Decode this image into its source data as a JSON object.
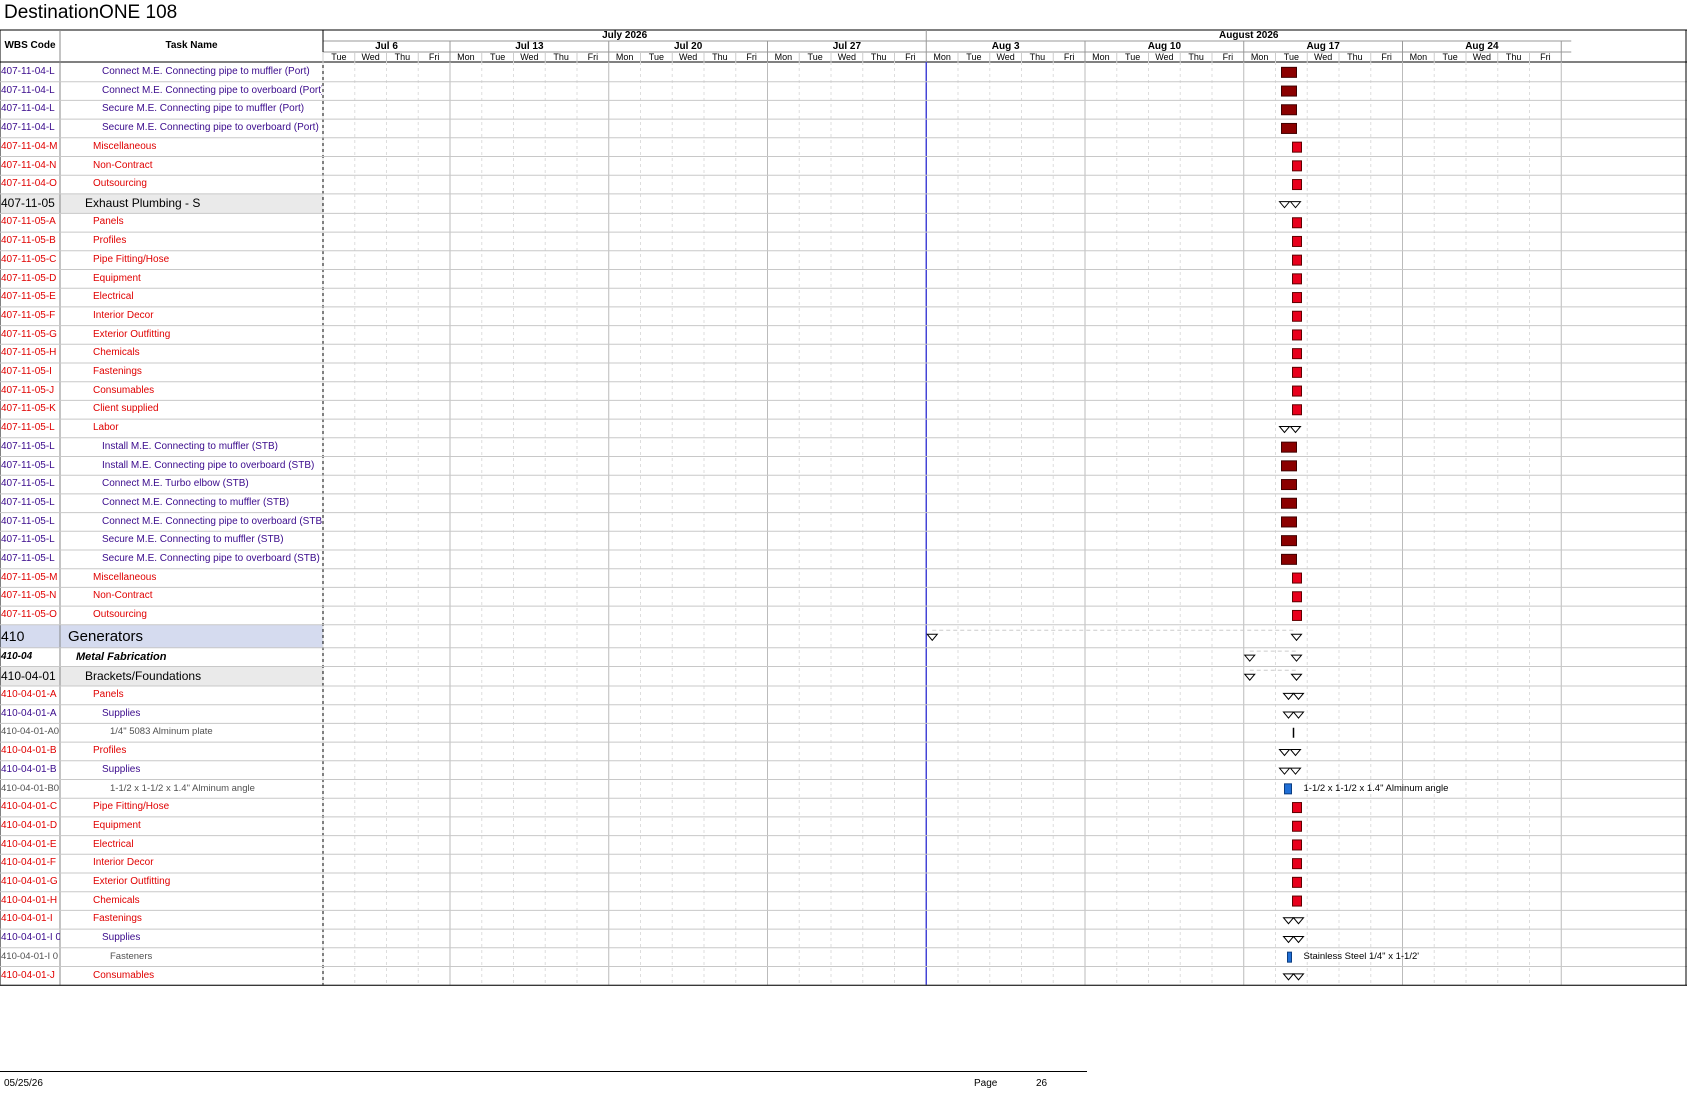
{
  "document": {
    "title": "DestinationONE 108"
  },
  "table_headers": {
    "wbs": "WBS Code",
    "name": "Task Name"
  },
  "months": [
    {
      "label": "July 2026"
    },
    {
      "label": "August 2026"
    }
  ],
  "weeks": [
    {
      "label": "Jul 6"
    },
    {
      "label": "Jul 13"
    },
    {
      "label": "Jul 20"
    },
    {
      "label": "Jul 27"
    },
    {
      "label": "Aug 3"
    },
    {
      "label": "Aug 10"
    },
    {
      "label": "Aug 17"
    },
    {
      "label": "Aug 24"
    }
  ],
  "days": [
    "Tue",
    "Wed",
    "Thu",
    "Fri",
    "Mon",
    "Tue",
    "Wed",
    "Thu",
    "Fri",
    "Mon",
    "Tue",
    "Wed",
    "Thu",
    "Fri",
    "Mon",
    "Tue",
    "Wed",
    "Thu",
    "Fri",
    "Mon",
    "Tue",
    "Wed",
    "Thu",
    "Fri",
    "Mon",
    "Tue",
    "Wed",
    "Thu",
    "Fri",
    "Mon",
    "Tue",
    "Wed",
    "Thu",
    "Fri",
    "Mon",
    "Tue",
    "Wed",
    "Thu",
    "Fri"
  ],
  "colors": {
    "red_text": "#e00000",
    "purple_text": "#3a0a8c",
    "gray_text": "#505050",
    "dark_red_bar": "#8b0000",
    "red_bar": "#e8001c",
    "blue_bar": "#1f6fd6",
    "summary_bg": "#eaeaea",
    "level1_bg": "#d5dbef",
    "status_line": "#3b3bd6"
  },
  "rows": [
    {
      "wbs": "407-11-04-L",
      "name": "Connect M.E. Connecting pipe to muffler (Port)",
      "style": "purple",
      "indent": 2,
      "bar": "darkred"
    },
    {
      "wbs": "407-11-04-L",
      "name": "Connect M.E. Connecting pipe to overboard (Port)",
      "style": "purple",
      "indent": 2,
      "bar": "darkred"
    },
    {
      "wbs": "407-11-04-L",
      "name": "Secure M.E. Connecting pipe to muffler (Port)",
      "style": "purple",
      "indent": 2,
      "bar": "darkred"
    },
    {
      "wbs": "407-11-04-L",
      "name": "Secure M.E. Connecting pipe to overboard (Port)",
      "style": "purple",
      "indent": 2,
      "bar": "darkred"
    },
    {
      "wbs": "407-11-04-M",
      "name": "Miscellaneous",
      "style": "red",
      "indent": 1,
      "bar": "red"
    },
    {
      "wbs": "407-11-04-N",
      "name": "Non-Contract",
      "style": "red",
      "indent": 1,
      "bar": "red"
    },
    {
      "wbs": "407-11-04-O",
      "name": "Outsourcing",
      "style": "red",
      "indent": 1,
      "bar": "red"
    },
    {
      "wbs": "407-11-05",
      "name": "Exhaust Plumbing - S",
      "style": "summary",
      "indent": 0,
      "bar": "summary"
    },
    {
      "wbs": "407-11-05-A",
      "name": "Panels",
      "style": "red",
      "indent": 1,
      "bar": "red"
    },
    {
      "wbs": "407-11-05-B",
      "name": "Profiles",
      "style": "red",
      "indent": 1,
      "bar": "red"
    },
    {
      "wbs": "407-11-05-C",
      "name": "Pipe Fitting/Hose",
      "style": "red",
      "indent": 1,
      "bar": "red"
    },
    {
      "wbs": "407-11-05-D",
      "name": "Equipment",
      "style": "red",
      "indent": 1,
      "bar": "red"
    },
    {
      "wbs": "407-11-05-E",
      "name": "Electrical",
      "style": "red",
      "indent": 1,
      "bar": "red"
    },
    {
      "wbs": "407-11-05-F",
      "name": "Interior Decor",
      "style": "red",
      "indent": 1,
      "bar": "red"
    },
    {
      "wbs": "407-11-05-G",
      "name": "Exterior Outfitting",
      "style": "red",
      "indent": 1,
      "bar": "red"
    },
    {
      "wbs": "407-11-05-H",
      "name": "Chemicals",
      "style": "red",
      "indent": 1,
      "bar": "red"
    },
    {
      "wbs": "407-11-05-I",
      "name": "Fastenings",
      "style": "red",
      "indent": 1,
      "bar": "red"
    },
    {
      "wbs": "407-11-05-J",
      "name": "Consumables",
      "style": "red",
      "indent": 1,
      "bar": "red"
    },
    {
      "wbs": "407-11-05-K",
      "name": "Client supplied",
      "style": "red",
      "indent": 1,
      "bar": "red"
    },
    {
      "wbs": "407-11-05-L",
      "name": "Labor",
      "style": "red",
      "indent": 1,
      "bar": "summary"
    },
    {
      "wbs": "407-11-05-L",
      "name": "Install M.E. Connecting to muffler (STB)",
      "style": "purple",
      "indent": 2,
      "bar": "darkred"
    },
    {
      "wbs": "407-11-05-L",
      "name": "Install M.E. Connecting pipe to overboard (STB)",
      "style": "purple",
      "indent": 2,
      "bar": "darkred"
    },
    {
      "wbs": "407-11-05-L",
      "name": "Connect M.E. Turbo elbow (STB)",
      "style": "purple",
      "indent": 2,
      "bar": "darkred"
    },
    {
      "wbs": "407-11-05-L",
      "name": "Connect M.E. Connecting to muffler (STB)",
      "style": "purple",
      "indent": 2,
      "bar": "darkred"
    },
    {
      "wbs": "407-11-05-L",
      "name": "Connect M.E. Connecting pipe to overboard (STB)",
      "style": "purple",
      "indent": 2,
      "bar": "darkred"
    },
    {
      "wbs": "407-11-05-L",
      "name": "Secure M.E. Connecting to muffler (STB)",
      "style": "purple",
      "indent": 2,
      "bar": "darkred"
    },
    {
      "wbs": "407-11-05-L",
      "name": "Secure M.E. Connecting pipe to overboard (STB)",
      "style": "purple",
      "indent": 2,
      "bar": "darkred"
    },
    {
      "wbs": "407-11-05-M",
      "name": "Miscellaneous",
      "style": "red",
      "indent": 1,
      "bar": "red"
    },
    {
      "wbs": "407-11-05-N",
      "name": "Non-Contract",
      "style": "red",
      "indent": 1,
      "bar": "red"
    },
    {
      "wbs": "407-11-05-O",
      "name": "Outsourcing",
      "style": "red",
      "indent": 1,
      "bar": "red"
    },
    {
      "wbs": "410",
      "name": "Generators",
      "style": "level1",
      "indent": 0,
      "bar": "summary-long"
    },
    {
      "wbs": "410-04",
      "name": "Metal Fabrication",
      "style": "level2",
      "indent": 0,
      "bar": "summary-mid"
    },
    {
      "wbs": "410-04-01",
      "name": "Brackets/Foundations",
      "style": "summary",
      "indent": 0,
      "bar": "summary-mid"
    },
    {
      "wbs": "410-04-01-A",
      "name": "Panels",
      "style": "red",
      "indent": 1,
      "bar": "summary-double"
    },
    {
      "wbs": "410-04-01-A",
      "name": "Supplies",
      "style": "purple",
      "indent": 2,
      "bar": "summary-double"
    },
    {
      "wbs": "410-04-01-A0",
      "name": "1/4\" 5083 Alminum plate",
      "style": "gray",
      "indent": 3,
      "bar": "tick"
    },
    {
      "wbs": "410-04-01-B",
      "name": "Profiles",
      "style": "red",
      "indent": 1,
      "bar": "summary"
    },
    {
      "wbs": "410-04-01-B",
      "name": "Supplies",
      "style": "purple",
      "indent": 2,
      "bar": "summary"
    },
    {
      "wbs": "410-04-01-B0",
      "name": "1-1/2 x 1-1/2 x 1.4\" Alminum angle",
      "style": "gray",
      "indent": 3,
      "bar": "blue",
      "bar_label": "1-1/2 x 1-1/2 x 1.4\" Alminum angle"
    },
    {
      "wbs": "410-04-01-C",
      "name": "Pipe Fitting/Hose",
      "style": "red",
      "indent": 1,
      "bar": "red"
    },
    {
      "wbs": "410-04-01-D",
      "name": "Equipment",
      "style": "red",
      "indent": 1,
      "bar": "red"
    },
    {
      "wbs": "410-04-01-E",
      "name": "Electrical",
      "style": "red",
      "indent": 1,
      "bar": "red"
    },
    {
      "wbs": "410-04-01-F",
      "name": "Interior Decor",
      "style": "red",
      "indent": 1,
      "bar": "red"
    },
    {
      "wbs": "410-04-01-G",
      "name": "Exterior Outfitting",
      "style": "red",
      "indent": 1,
      "bar": "red"
    },
    {
      "wbs": "410-04-01-H",
      "name": "Chemicals",
      "style": "red",
      "indent": 1,
      "bar": "red"
    },
    {
      "wbs": "410-04-01-I",
      "name": "Fastenings",
      "style": "red",
      "indent": 1,
      "bar": "summary-double"
    },
    {
      "wbs": "410-04-01-I 0",
      "name": "Supplies",
      "style": "purple",
      "indent": 2,
      "bar": "summary-double"
    },
    {
      "wbs": "410-04-01-I 0",
      "name": "Fasteners",
      "style": "gray",
      "indent": 3,
      "bar": "blue-thin",
      "bar_label": "Stainless Steel 1/4\" x 1-1/2'"
    },
    {
      "wbs": "410-04-01-J",
      "name": "Consumables",
      "style": "red",
      "indent": 1,
      "bar": "summary-double"
    }
  ],
  "footer": {
    "date": "05/25/26",
    "page_label": "Page",
    "page_number": "26"
  }
}
